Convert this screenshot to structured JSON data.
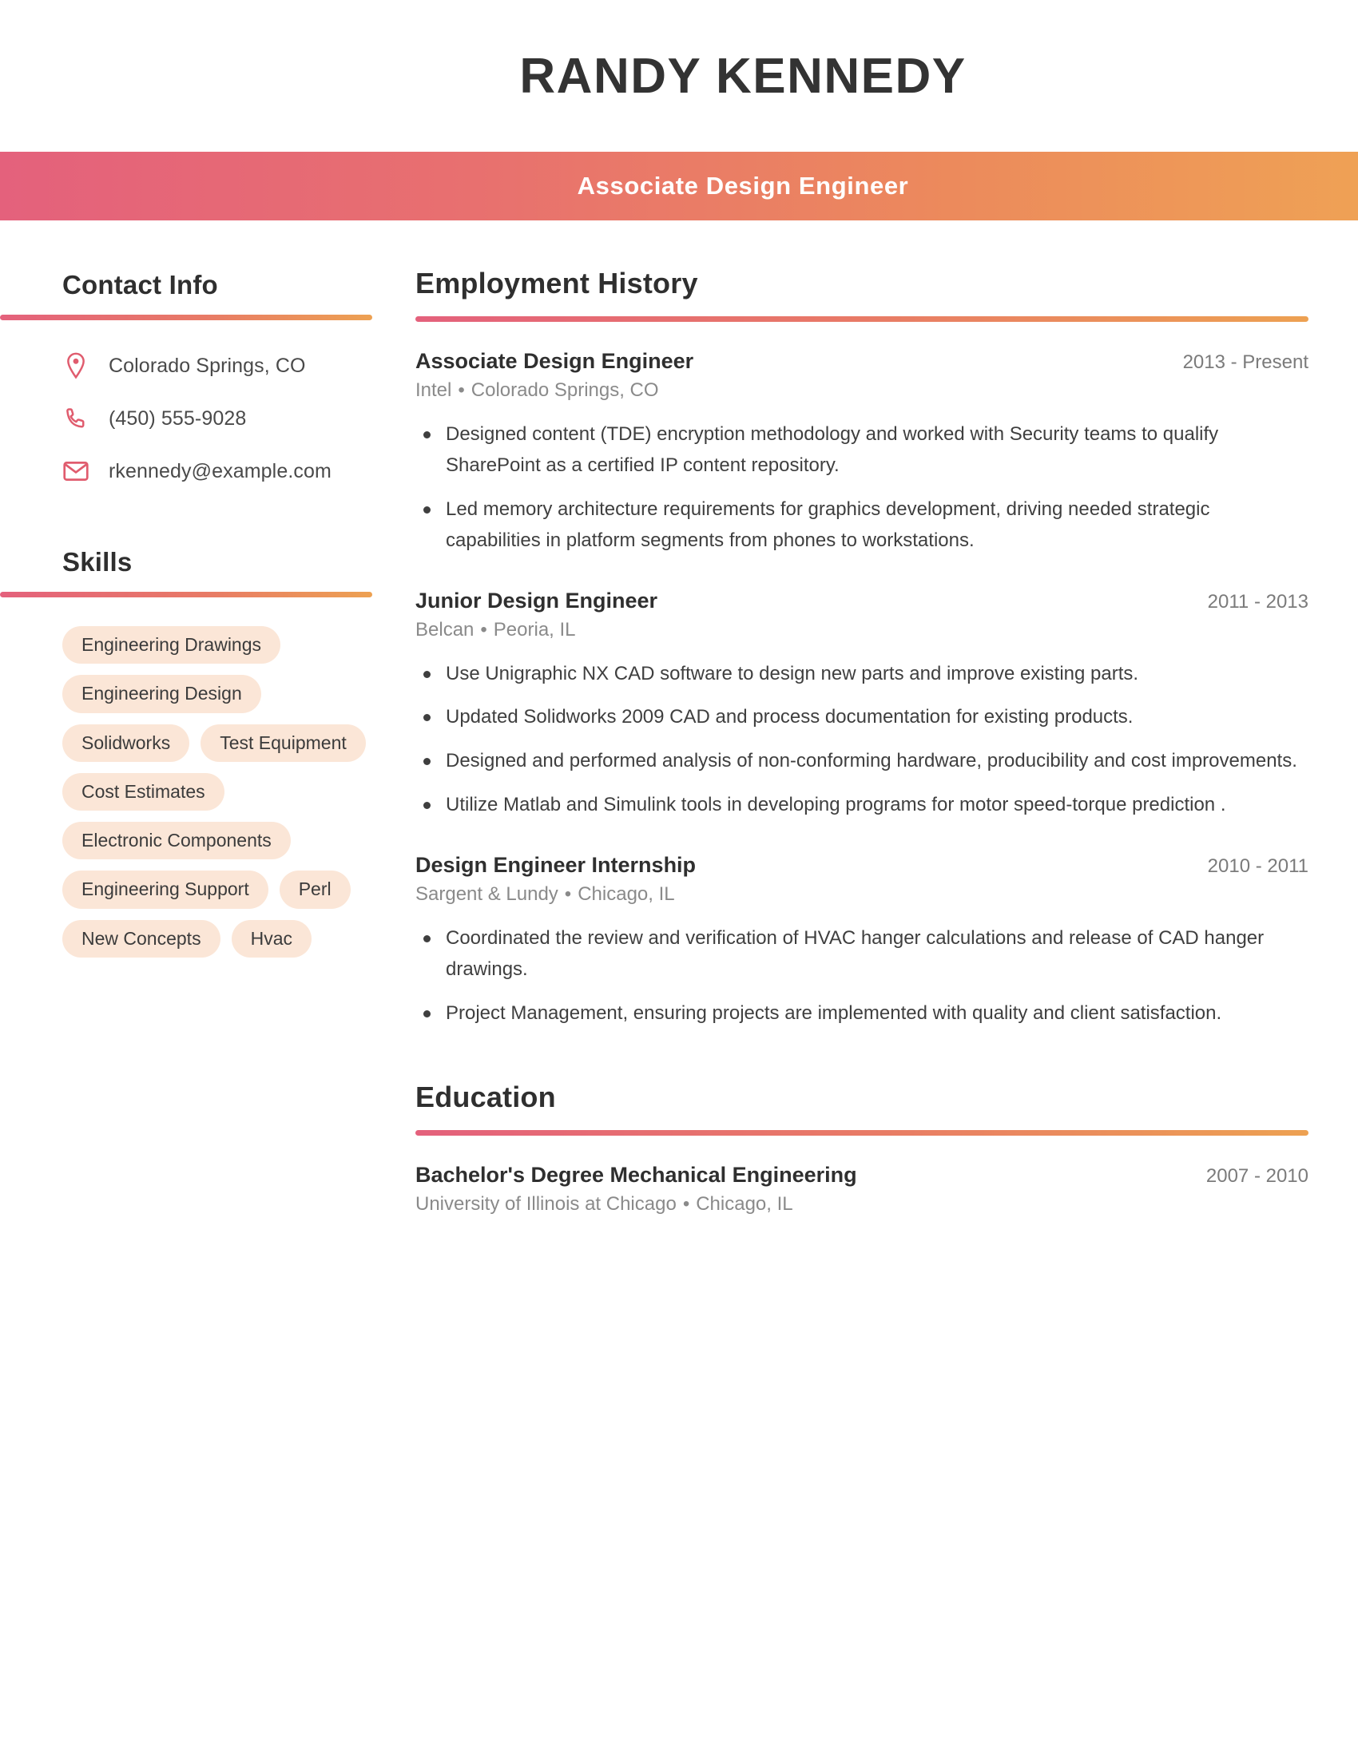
{
  "header": {
    "name": "RANDY KENNEDY",
    "job_title": "Associate Design Engineer"
  },
  "colors": {
    "gradient_start": "#e4617c",
    "gradient_end": "#efa155",
    "icon": "#e05c6e",
    "pill_bg": "#fbe6d7",
    "heading": "#2f2f2f",
    "muted_text": "#8a8a8a"
  },
  "sidebar": {
    "contact": {
      "heading": "Contact Info",
      "items": [
        {
          "icon": "location-pin-icon",
          "value": "Colorado Springs, CO"
        },
        {
          "icon": "phone-icon",
          "value": "(450) 555-9028"
        },
        {
          "icon": "envelope-icon",
          "value": "rkennedy@example.com"
        }
      ]
    },
    "skills": {
      "heading": "Skills",
      "items": [
        "Engineering Drawings",
        "Engineering Design",
        "Solidworks",
        "Test Equipment",
        "Cost Estimates",
        "Electronic Components",
        "Engineering Support",
        "Perl",
        "New Concepts",
        "Hvac"
      ]
    }
  },
  "main": {
    "employment": {
      "heading": "Employment History",
      "entries": [
        {
          "title": "Associate Design Engineer",
          "dates": "2013 - Present",
          "company": "Intel",
          "location": "Colorado Springs, CO",
          "bullets": [
            "Designed content (TDE) encryption methodology and worked with Security teams to qualify SharePoint as a certified IP content repository.",
            "Led memory architecture requirements for graphics development, driving needed strategic capabilities in platform segments from phones to workstations."
          ]
        },
        {
          "title": "Junior Design Engineer",
          "dates": "2011 - 2013",
          "company": "Belcan",
          "location": "Peoria, IL",
          "bullets": [
            "Use Unigraphic NX CAD software to design new parts and improve existing parts.",
            "Updated Solidworks 2009 CAD and process documentation for existing products.",
            "Designed and performed analysis of non-conforming hardware, producibility and cost improvements.",
            "Utilize Matlab and Simulink tools in developing programs for motor speed-torque prediction ."
          ]
        },
        {
          "title": "Design Engineer Internship",
          "dates": "2010 - 2011",
          "company": "Sargent & Lundy",
          "location": "Chicago, IL",
          "bullets": [
            "Coordinated the review and verification of HVAC hanger calculations and release of CAD hanger drawings.",
            "Project Management, ensuring projects are implemented with quality and client satisfaction."
          ]
        }
      ]
    },
    "education": {
      "heading": "Education",
      "entries": [
        {
          "title": "Bachelor's Degree Mechanical Engineering",
          "dates": "2007 - 2010",
          "school": "University of Illinois at Chicago",
          "location": "Chicago, IL"
        }
      ]
    }
  }
}
